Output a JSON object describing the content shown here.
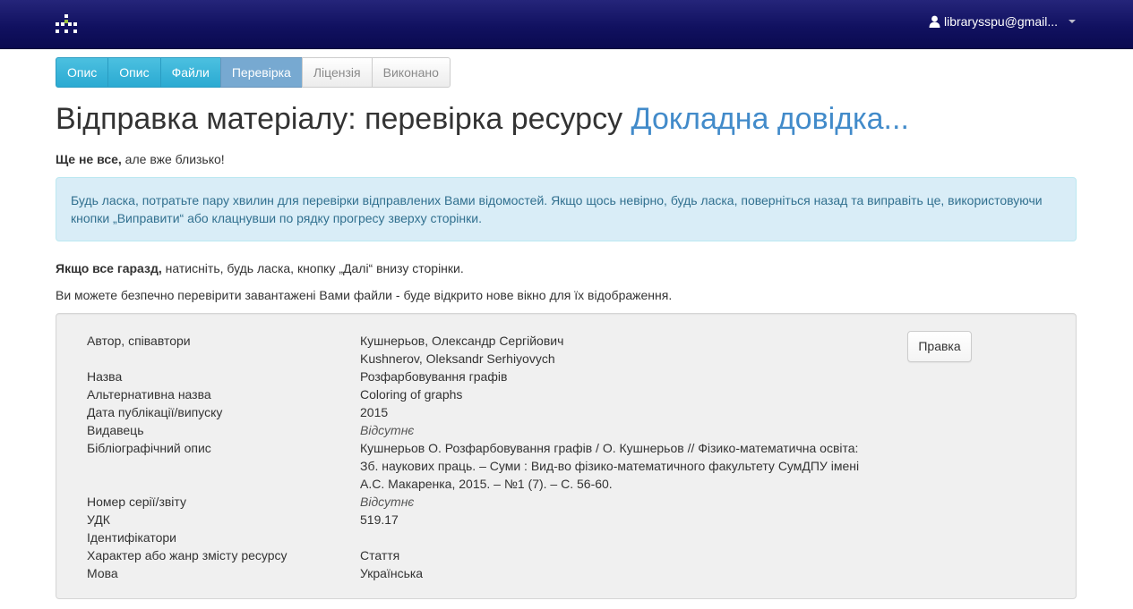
{
  "navbar": {
    "logo_icon": "dspace-logo-icon",
    "user_icon": "user-icon",
    "user_email": "librarysspu@gmail..."
  },
  "progress_steps": [
    {
      "label": "Опис",
      "state": "done"
    },
    {
      "label": "Опис",
      "state": "done"
    },
    {
      "label": "Файли",
      "state": "done"
    },
    {
      "label": "Перевірка",
      "state": "current"
    },
    {
      "label": "Ліцензія",
      "state": "todo"
    },
    {
      "label": "Виконано",
      "state": "todo"
    }
  ],
  "heading": {
    "title": "Відправка матеріалу: перевірка ресурсу",
    "help_link": "Докладна довідка..."
  },
  "intro": {
    "bold": "Ще не все,",
    "rest": " але вже близько!"
  },
  "alert": {
    "text": "Будь ласка, потратьте пару хвилин для перевірки відправлених Вами відомостей. Якщо щось невірно, будь ласка, поверніться назад та виправіть це, використовуючи кнопки „Виправити“ або клацнувши по рядку прогресу зверху сторінки."
  },
  "instruction": {
    "bold": "Якщо все гаразд,",
    "rest": " натисніть, будь ласка, кнопку „Далі“ внизу сторінки."
  },
  "files_note": "Ви можете безпечно перевірити завантажені Вами файли - буде відкрито нове вікно для їх відображення.",
  "review": {
    "edit_button": "Правка",
    "fields": [
      {
        "label": "Автор, співавтори",
        "values": [
          "Кушнерьов, Олександр Сергійович",
          "Kushnerov, Oleksandr Serhiyovych"
        ]
      },
      {
        "label": "Назва",
        "values": [
          "Розфарбовування графів"
        ]
      },
      {
        "label": "Альтернативна назва",
        "values": [
          "Coloring of graphs"
        ]
      },
      {
        "label": "Дата публікації/випуску",
        "values": [
          "2015"
        ]
      },
      {
        "label": "Видавець",
        "values": [
          "Відсутнє"
        ],
        "missing": true
      },
      {
        "label": "Бібліографічний опис",
        "values": [
          "Кушнерьов О. Розфарбовування графів / О. Кушнерьов // Фізико-математична освіта:",
          "Зб. наукових праць. – Суми : Вид-во фізико-математичного факультету СумДПУ імені",
          "А.С. Макаренка, 2015. – №1 (7). – С. 56-60."
        ]
      },
      {
        "label": "Номер серії/звіту",
        "values": [
          "Відсутнє"
        ],
        "missing": true
      },
      {
        "label": "УДК",
        "values": [
          "519.17"
        ]
      },
      {
        "label": "Ідентифікатори",
        "values": [
          ""
        ]
      },
      {
        "label": "Характер або жанр змісту ресурсу",
        "values": [
          "Стаття"
        ]
      },
      {
        "label": "Мова",
        "values": [
          "Українська"
        ]
      }
    ]
  }
}
